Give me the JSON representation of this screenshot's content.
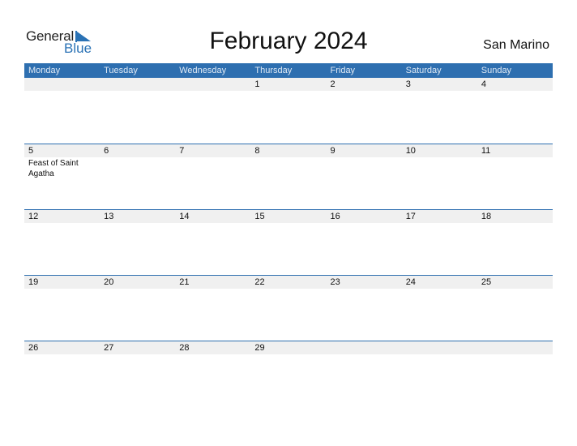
{
  "logo": {
    "general": "General",
    "blue": "Blue"
  },
  "title": "February 2024",
  "country": "San Marino",
  "colors": {
    "accent": "#2e6fb0",
    "strip": "#f0f0f0"
  },
  "weekdays": [
    "Monday",
    "Tuesday",
    "Wednesday",
    "Thursday",
    "Friday",
    "Saturday",
    "Sunday"
  ],
  "weeks": [
    [
      {
        "day": ""
      },
      {
        "day": ""
      },
      {
        "day": ""
      },
      {
        "day": "1"
      },
      {
        "day": "2"
      },
      {
        "day": "3"
      },
      {
        "day": "4"
      }
    ],
    [
      {
        "day": "5",
        "event": "Feast of Saint Agatha"
      },
      {
        "day": "6"
      },
      {
        "day": "7"
      },
      {
        "day": "8"
      },
      {
        "day": "9"
      },
      {
        "day": "10"
      },
      {
        "day": "11"
      }
    ],
    [
      {
        "day": "12"
      },
      {
        "day": "13"
      },
      {
        "day": "14"
      },
      {
        "day": "15"
      },
      {
        "day": "16"
      },
      {
        "day": "17"
      },
      {
        "day": "18"
      }
    ],
    [
      {
        "day": "19"
      },
      {
        "day": "20"
      },
      {
        "day": "21"
      },
      {
        "day": "22"
      },
      {
        "day": "23"
      },
      {
        "day": "24"
      },
      {
        "day": "25"
      }
    ],
    [
      {
        "day": "26"
      },
      {
        "day": "27"
      },
      {
        "day": "28"
      },
      {
        "day": "29"
      },
      {
        "day": ""
      },
      {
        "day": ""
      },
      {
        "day": ""
      }
    ]
  ]
}
